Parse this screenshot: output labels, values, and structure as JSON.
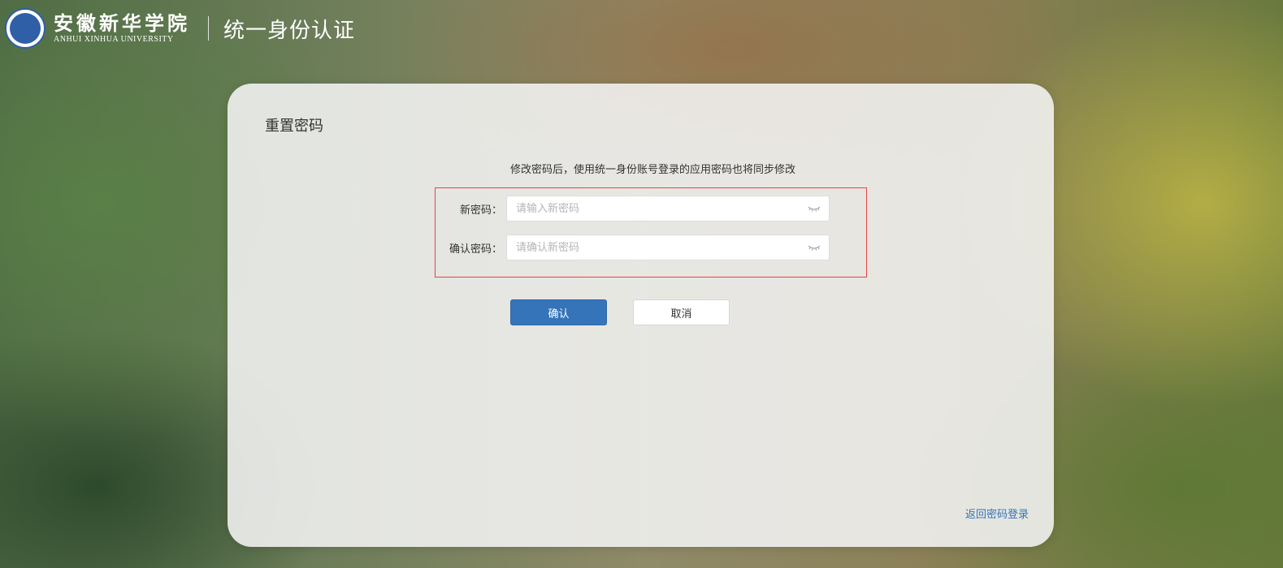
{
  "header": {
    "logo_cn": "安徽新华学院",
    "logo_en": "ANHUI XINHUA UNIVERSITY",
    "title": "统一身份认证"
  },
  "card": {
    "title": "重置密码",
    "notice": "修改密码后，使用统一身份账号登录的应用密码也将同步修改"
  },
  "form": {
    "new_password": {
      "label": "新密码：",
      "placeholder": "请输入新密码",
      "value": ""
    },
    "confirm_password": {
      "label": "确认密码：",
      "placeholder": "请确认新密码",
      "value": ""
    }
  },
  "buttons": {
    "confirm_label": "确认",
    "cancel_label": "取消"
  },
  "links": {
    "back_to_login": "返回密码登录"
  },
  "colors": {
    "primary": "#3574b9",
    "error_border": "#e64545"
  },
  "icons": {
    "password_toggle": "eye-closed-icon"
  }
}
